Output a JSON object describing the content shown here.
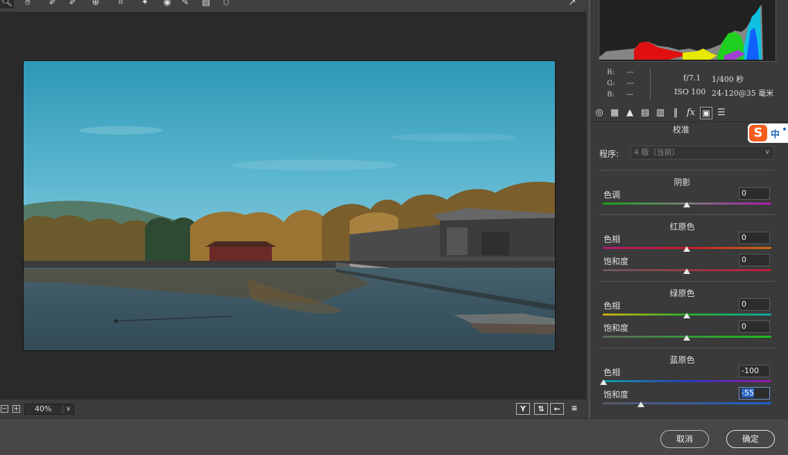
{
  "toolbar": {
    "tools": [
      "zoom-tool",
      "hand-tool",
      "white-balance-tool",
      "color-sampler-tool",
      "targeted-adjustment-tool",
      "crop-tool",
      "straighten-tool",
      "spot-removal-tool",
      "red-eye-tool",
      "adjustment-brush-tool",
      "graduated-filter-tool",
      "radial-filter-tool"
    ]
  },
  "canvas": {
    "zoom_value": "40%"
  },
  "info": {
    "r_label": "R:",
    "r_value": "---",
    "g_label": "G:",
    "g_value": "---",
    "b_label": "B:",
    "b_value": "---",
    "aperture": "f/7.1",
    "shutter": "1/400 秒",
    "iso": "ISO 100",
    "lens": "24-120@35 毫米"
  },
  "panel": {
    "title": "校准",
    "process_label": "程序:",
    "process_value": "4 版（当前）",
    "shadows": {
      "header": "阴影",
      "tint_label": "色调",
      "tint_value": "0",
      "tint_level": 0
    },
    "red": {
      "header": "红原色",
      "hue_label": "色相",
      "hue_value": "0",
      "sat_label": "饱和度",
      "sat_value": "0"
    },
    "green": {
      "header": "绿原色",
      "hue_label": "色相",
      "hue_value": "0",
      "sat_label": "饱和度",
      "sat_value": "0"
    },
    "blue": {
      "header": "蓝原色",
      "hue_label": "色相",
      "hue_value": "-100",
      "sat_label": "饱和度",
      "sat_value": "-55"
    }
  },
  "footer": {
    "cancel_label": "取消",
    "ok_label": "确定"
  },
  "ime": {
    "logo": "S",
    "mode": "中"
  },
  "colors": {
    "canvas_bg": "#2a2a2a",
    "panel_bg": "#3a3a3a",
    "sky_top": "#3aa2bd",
    "water": "#3b5866"
  }
}
